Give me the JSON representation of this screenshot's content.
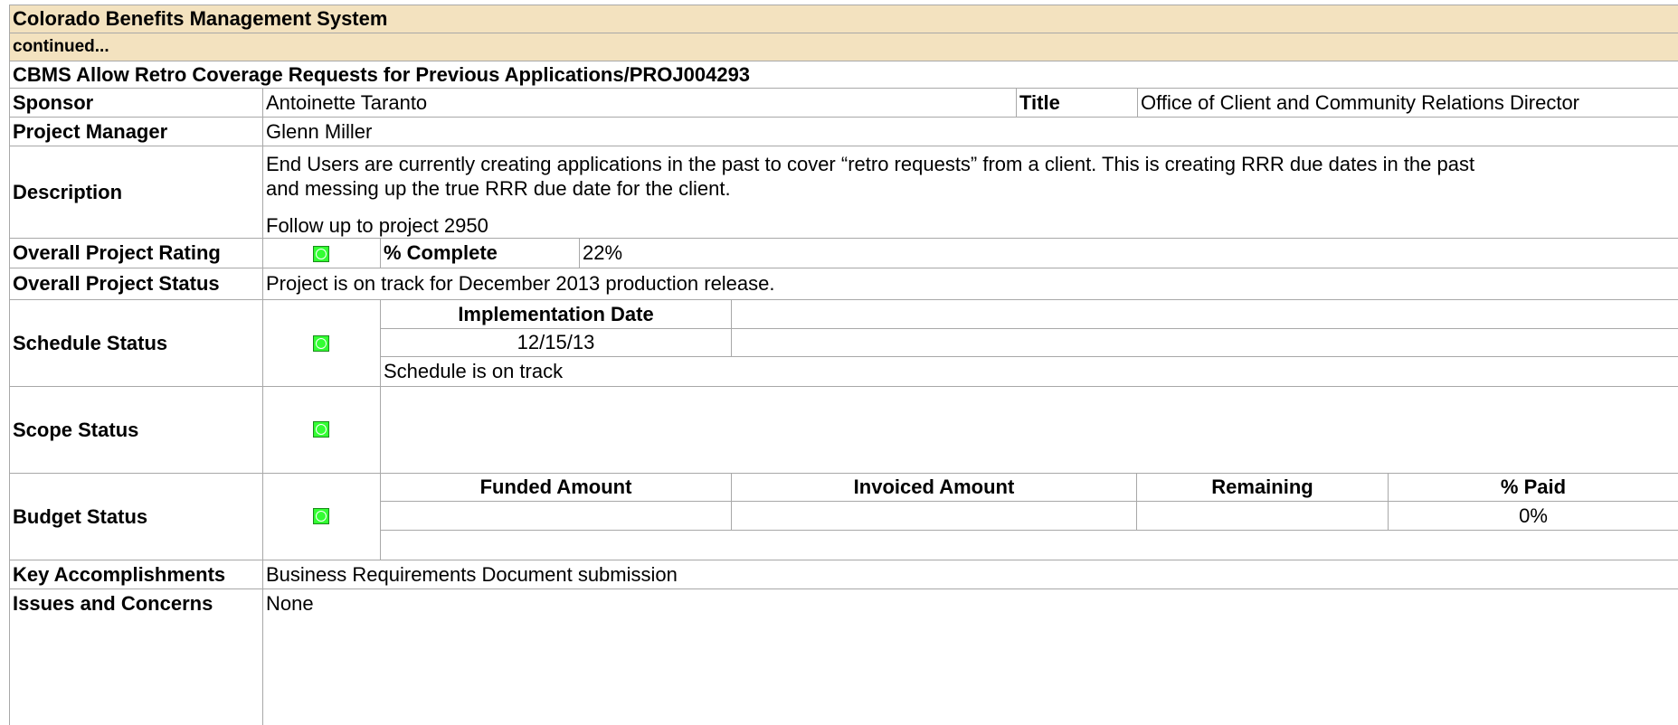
{
  "header": {
    "system_title": "Colorado Benefits Management System",
    "continued": "continued..."
  },
  "project": {
    "title": "CBMS Allow Retro Coverage Requests for Previous Applications/PROJ004293",
    "sponsor_label": "Sponsor",
    "sponsor": "Antoinette Taranto",
    "title_label": "Title",
    "sponsor_title": "Office of Client and Community Relations Director",
    "pm_label": "Project Manager",
    "pm": "Glenn Miller",
    "description_label": "Description",
    "description_line1": "End Users are currently creating applications in the past to cover “retro requests” from a client.  This is creating RRR due dates in the past",
    "description_line2": "and messing up the true RRR due date for the client.",
    "description_line3": "Follow up to project 2950",
    "rating_label": "Overall Project Rating",
    "rating_indicator": "green-status-icon",
    "complete_label": "% Complete",
    "complete_value": "22%",
    "overall_status_label": "Overall Project Status",
    "overall_status": "Project is on track for December 2013 production release."
  },
  "schedule": {
    "label": "Schedule Status",
    "indicator": "green-status-icon",
    "impl_date_header": "Implementation Date",
    "impl_date": "12/15/13",
    "note": "Schedule is on track"
  },
  "scope": {
    "label": "Scope Status",
    "indicator": "green-status-icon"
  },
  "budget": {
    "label": "Budget Status",
    "indicator": "green-status-icon",
    "funded_header": "Funded Amount",
    "invoiced_header": "Invoiced Amount",
    "remaining_header": "Remaining",
    "paid_header": "% Paid",
    "paid_value": "0%"
  },
  "accomplishments": {
    "label": "Key Accomplishments",
    "value": "Business Requirements Document submission"
  },
  "issues": {
    "label": "Issues and Concerns",
    "value": "None"
  },
  "colors": {
    "header_band": "#f3e2bf",
    "status_green": "#33ff33",
    "grid_line": "#a8a8a8"
  }
}
